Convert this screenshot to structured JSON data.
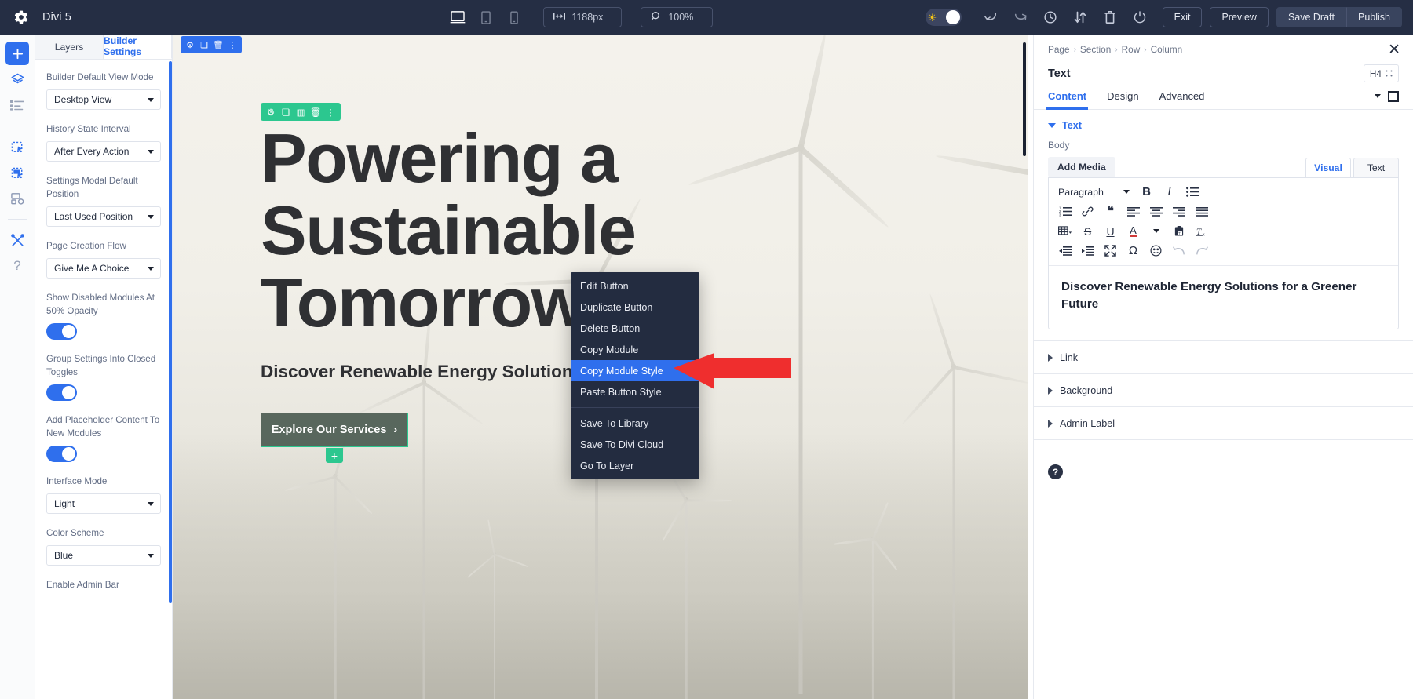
{
  "topbar": {
    "gear_icon": "gear-icon",
    "title": "Divi 5",
    "devices": [
      {
        "name": "desktop-view-icon",
        "active": true
      },
      {
        "name": "tablet-view-icon",
        "active": false
      },
      {
        "name": "phone-view-icon",
        "active": false
      }
    ],
    "width_value": "1188px",
    "zoom_value": "100%",
    "theme_toggle": "light-dark-toggle",
    "icons": [
      "undo-icon",
      "redo-icon",
      "history-icon",
      "sort-icon",
      "trash-icon",
      "power-icon"
    ],
    "exit_label": "Exit",
    "preview_label": "Preview",
    "save_draft_label": "Save Draft",
    "publish_label": "Publish"
  },
  "rail": {
    "items": [
      {
        "name": "add-icon",
        "glyph": "+"
      },
      {
        "name": "layers-icon",
        "glyph": ""
      },
      {
        "name": "list-icon",
        "glyph": ""
      },
      {
        "name": "copy-select-icon",
        "glyph": ""
      },
      {
        "name": "multi-select-icon",
        "glyph": ""
      },
      {
        "name": "responsive-icon",
        "glyph": ""
      },
      {
        "name": "tools-icon",
        "glyph": ""
      },
      {
        "name": "help-icon",
        "glyph": "?"
      }
    ]
  },
  "left_panel": {
    "tabs": [
      {
        "label": "Layers",
        "active": false
      },
      {
        "label": "Builder Settings",
        "active": true
      }
    ],
    "fields": [
      {
        "type": "select",
        "label": "Builder Default View Mode",
        "value": "Desktop View"
      },
      {
        "type": "select",
        "label": "History State Interval",
        "value": "After Every Action"
      },
      {
        "type": "select",
        "label": "Settings Modal Default Position",
        "value": "Last Used Position"
      },
      {
        "type": "select",
        "label": "Page Creation Flow",
        "value": "Give Me A Choice"
      },
      {
        "type": "toggle",
        "label": "Show Disabled Modules At 50% Opacity",
        "value": "on"
      },
      {
        "type": "toggle",
        "label": "Group Settings Into Closed Toggles",
        "value": "on"
      },
      {
        "type": "toggle",
        "label": "Add Placeholder Content To New Modules",
        "value": "on"
      },
      {
        "type": "select",
        "label": "Interface Mode",
        "value": "Light"
      },
      {
        "type": "select",
        "label": "Color Scheme",
        "value": "Blue"
      },
      {
        "type": "toggle-partial",
        "label": "Enable Admin Bar",
        "value": ""
      }
    ]
  },
  "canvas": {
    "section_tools": [
      "gear-icon",
      "duplicate-icon",
      "trash-icon",
      "more-icon"
    ],
    "module_tools": [
      "gear-icon",
      "duplicate-icon",
      "columns-icon",
      "trash-icon",
      "more-icon"
    ],
    "heading": "Powering a Sustainable Tomorrow",
    "subheading": "Discover Renewable Energy Solutions for a Greener Future",
    "cta_label": "Explore Our Services",
    "cta_chevron": "›",
    "cta_plus": "+",
    "row_add": "+"
  },
  "context_menu": {
    "groups": [
      [
        "Edit Button",
        "Duplicate Button",
        "Delete Button",
        "Copy Module",
        "Copy Module Style",
        "Paste Button Style"
      ],
      [
        "Save To Library",
        "Save To Divi Cloud",
        "Go To Layer"
      ]
    ],
    "active_item": "Copy Module Style",
    "active_color": "#2f6fed",
    "background_color": "#232c40"
  },
  "right_panel": {
    "breadcrumb": [
      "Page",
      "Section",
      "Row",
      "Column"
    ],
    "breadcrumb_sep": "›",
    "close_icon": "close-icon",
    "title": "Text",
    "tag_badge": "H4",
    "tabs": [
      {
        "label": "Content",
        "active": true
      },
      {
        "label": "Design",
        "active": false
      },
      {
        "label": "Advanced",
        "active": false
      }
    ],
    "section_text_label": "Text",
    "body_label": "Body",
    "add_media_label": "Add Media",
    "editor_tabs": [
      {
        "label": "Visual",
        "active": true
      },
      {
        "label": "Text",
        "active": false
      }
    ],
    "format_select": "Paragraph",
    "toolbar_rows": [
      [
        "bold-icon",
        "italic-icon",
        "bulleted-list-icon"
      ],
      [
        "numbered-list-icon",
        "link-icon",
        "blockquote-icon",
        "align-left-icon",
        "align-center-icon",
        "align-right-icon",
        "align-justify-icon"
      ],
      [
        "table-icon",
        "strikethrough-icon",
        "underline-icon",
        "text-color-icon",
        "paste-text-icon",
        "clear-formatting-icon"
      ],
      [
        "outdent-icon",
        "indent-icon",
        "fullscreen-icon",
        "special-character-icon",
        "emoji-icon",
        "undo-icon",
        "redo-icon"
      ]
    ],
    "editor_content": "Discover Renewable Energy Solutions for a Greener Future",
    "accordions": [
      {
        "label": "Link"
      },
      {
        "label": "Background"
      },
      {
        "label": "Admin Label"
      }
    ],
    "help_badge": "?"
  },
  "colors": {
    "topbar_bg": "#252e44",
    "accent_blue": "#2f6fed",
    "accent_green": "#2cc78f",
    "arrow_red": "#ef2e2e"
  }
}
